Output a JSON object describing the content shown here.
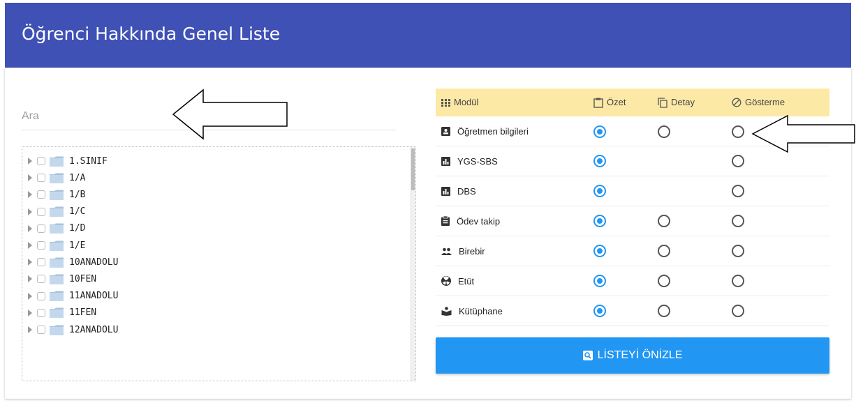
{
  "header": {
    "title": "Öğrenci Hakkında Genel Liste"
  },
  "search": {
    "placeholder": "Ara"
  },
  "tree": {
    "items": [
      "1.SINIF",
      "1/A",
      "1/B",
      "1/C",
      "1/D",
      "1/E",
      "10ANADOLU",
      "10FEN",
      "11ANADOLU",
      "11FEN",
      "12ANADOLU"
    ]
  },
  "table": {
    "columns": {
      "module": "Modül",
      "summary": "Özet",
      "detail": "Detay",
      "hide": "Gösterme"
    },
    "rows": [
      {
        "name": "Öğretmen bilgileri",
        "icon": "id-card-icon",
        "selected": "summary",
        "has_detail": true
      },
      {
        "name": "YGS-SBS",
        "icon": "bar-chart-icon",
        "selected": "summary",
        "has_detail": false
      },
      {
        "name": "DBS",
        "icon": "bar-chart-icon",
        "selected": "summary",
        "has_detail": false
      },
      {
        "name": "Ödev takip",
        "icon": "clipboard-icon",
        "selected": "summary",
        "has_detail": true
      },
      {
        "name": "Birebir",
        "icon": "users-icon",
        "selected": "summary",
        "has_detail": true
      },
      {
        "name": "Etüt",
        "icon": "radiation-icon",
        "selected": "summary",
        "has_detail": true
      },
      {
        "name": "Kütüphane",
        "icon": "reader-icon",
        "selected": "summary",
        "has_detail": true
      }
    ]
  },
  "preview_button": {
    "label": "LİSTEYİ ÖNİZLE"
  },
  "colors": {
    "header": "#3f51b5",
    "accent": "#2196f3",
    "table_head": "#fde9a6"
  }
}
